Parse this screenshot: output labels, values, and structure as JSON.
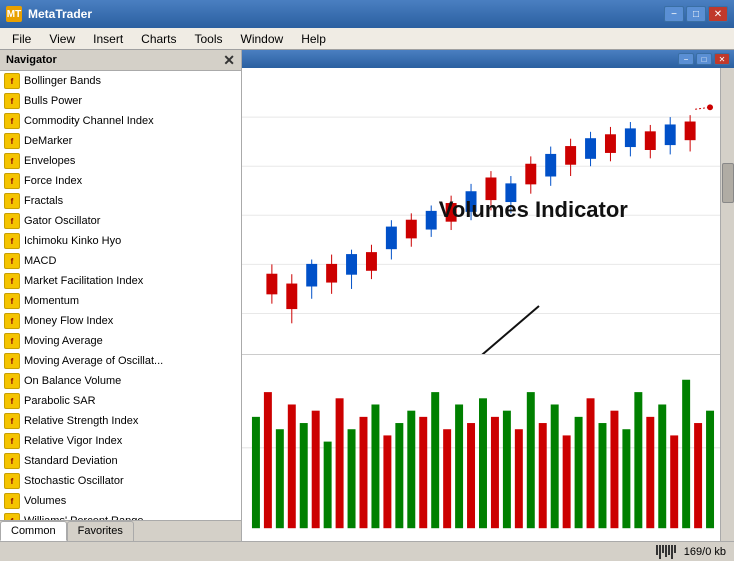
{
  "titleBar": {
    "icon": "MT",
    "title": "MetaTrader",
    "minimize": "−",
    "maximize": "□",
    "close": "✕"
  },
  "menuBar": {
    "items": [
      "File",
      "View",
      "Insert",
      "Charts",
      "Tools",
      "Window",
      "Help"
    ]
  },
  "navigator": {
    "title": "Navigator",
    "close": "✕",
    "indicators": [
      "Bollinger Bands",
      "Bulls Power",
      "Commodity Channel Index",
      "DeMarker",
      "Envelopes",
      "Force Index",
      "Fractals",
      "Gator Oscillator",
      "Ichimoku Kinko Hyo",
      "MACD",
      "Market Facilitation Index",
      "Momentum",
      "Money Flow Index",
      "Moving Average",
      "Moving Average of Oscillat...",
      "On Balance Volume",
      "Parabolic SAR",
      "Relative Strength Index",
      "Relative Vigor Index",
      "Standard Deviation",
      "Stochastic Oscillator",
      "Volumes",
      "Williams' Percent Range"
    ],
    "tabs": [
      "Common",
      "Favorites"
    ]
  },
  "chart": {
    "volumesLabel": "Volumes Indicator"
  },
  "statusBar": {
    "memory": "169/0 kb"
  }
}
